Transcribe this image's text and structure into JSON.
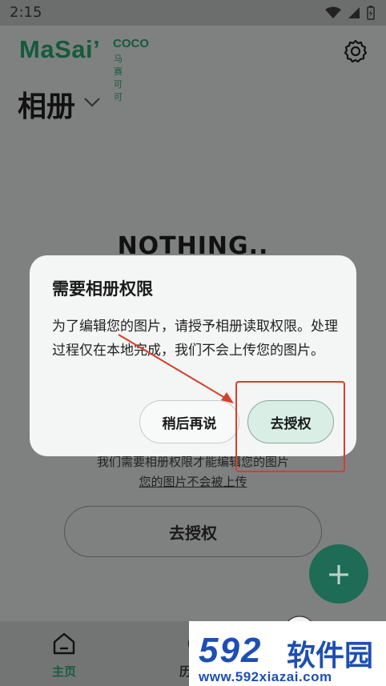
{
  "status_bar": {
    "time": "2:15"
  },
  "header": {
    "brand_main": "MaSai’",
    "brand_coco": "COCO",
    "brand_cn": "马赛可可",
    "title": "相册"
  },
  "background": {
    "empty_text": "NOTHING..",
    "need_permission_text": "我们需要相册权限才能编辑您的图片",
    "no_upload_link": "您的图片不会被上传",
    "authorize_button": "去授权"
  },
  "fab": {
    "label": "+"
  },
  "bottom_nav": {
    "items": [
      {
        "label": "主页",
        "active": true
      },
      {
        "label": "历"
      }
    ]
  },
  "dialog": {
    "title": "需要相册权限",
    "body": "为了编辑您的图片，请授予相册读取权限。处理过程仅在本地完成，我们不会上传您的图片。",
    "later_button": "稍后再说",
    "authorize_button": "去授权"
  },
  "watermark": {
    "brand": "592",
    "name": "软件园",
    "url": "www.592xiazai.com"
  },
  "colors": {
    "brand_green": "#155a3c",
    "fab_green": "#1e6b56",
    "annotation_red": "#d3402c",
    "watermark_blue": "#1d4fb3"
  }
}
